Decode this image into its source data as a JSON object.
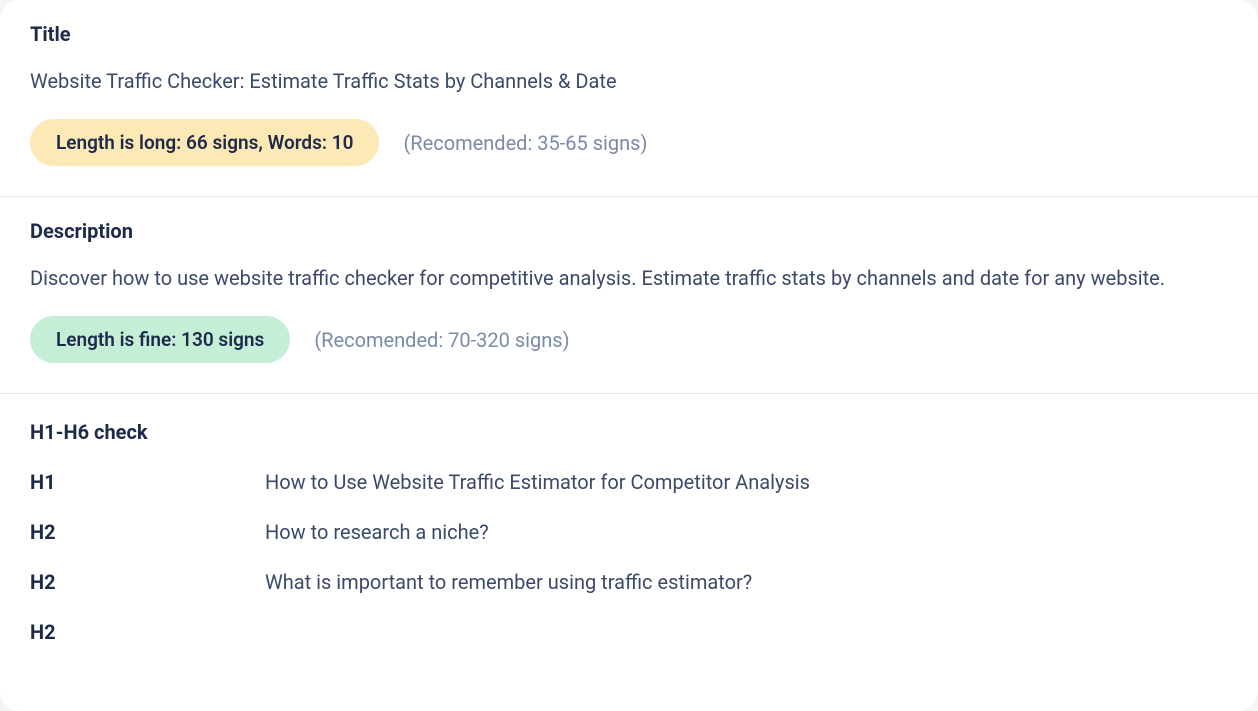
{
  "title": {
    "heading": "Title",
    "text": "Website Traffic Checker: Estimate Traffic Stats by Channels & Date",
    "badge_label": "Length is long: 66 signs, Words: 10",
    "recommended": "(Recomended: 35-65 signs)"
  },
  "description": {
    "heading": "Description",
    "text": "Discover how to use website traffic checker for competitive analysis. Estimate traffic stats by channels and date for any website.",
    "badge_label": "Length is fine: 130 signs",
    "recommended": "(Recomended: 70-320 signs)"
  },
  "headings": {
    "heading": "H1-H6 check",
    "items": [
      {
        "level": "H1",
        "text": "How to Use Website Traffic Estimator for Competitor Analysis"
      },
      {
        "level": "H2",
        "text": "How to research a niche?"
      },
      {
        "level": "H2",
        "text": "What is important to remember using traffic estimator?"
      },
      {
        "level": "H2",
        "text": ""
      }
    ]
  }
}
